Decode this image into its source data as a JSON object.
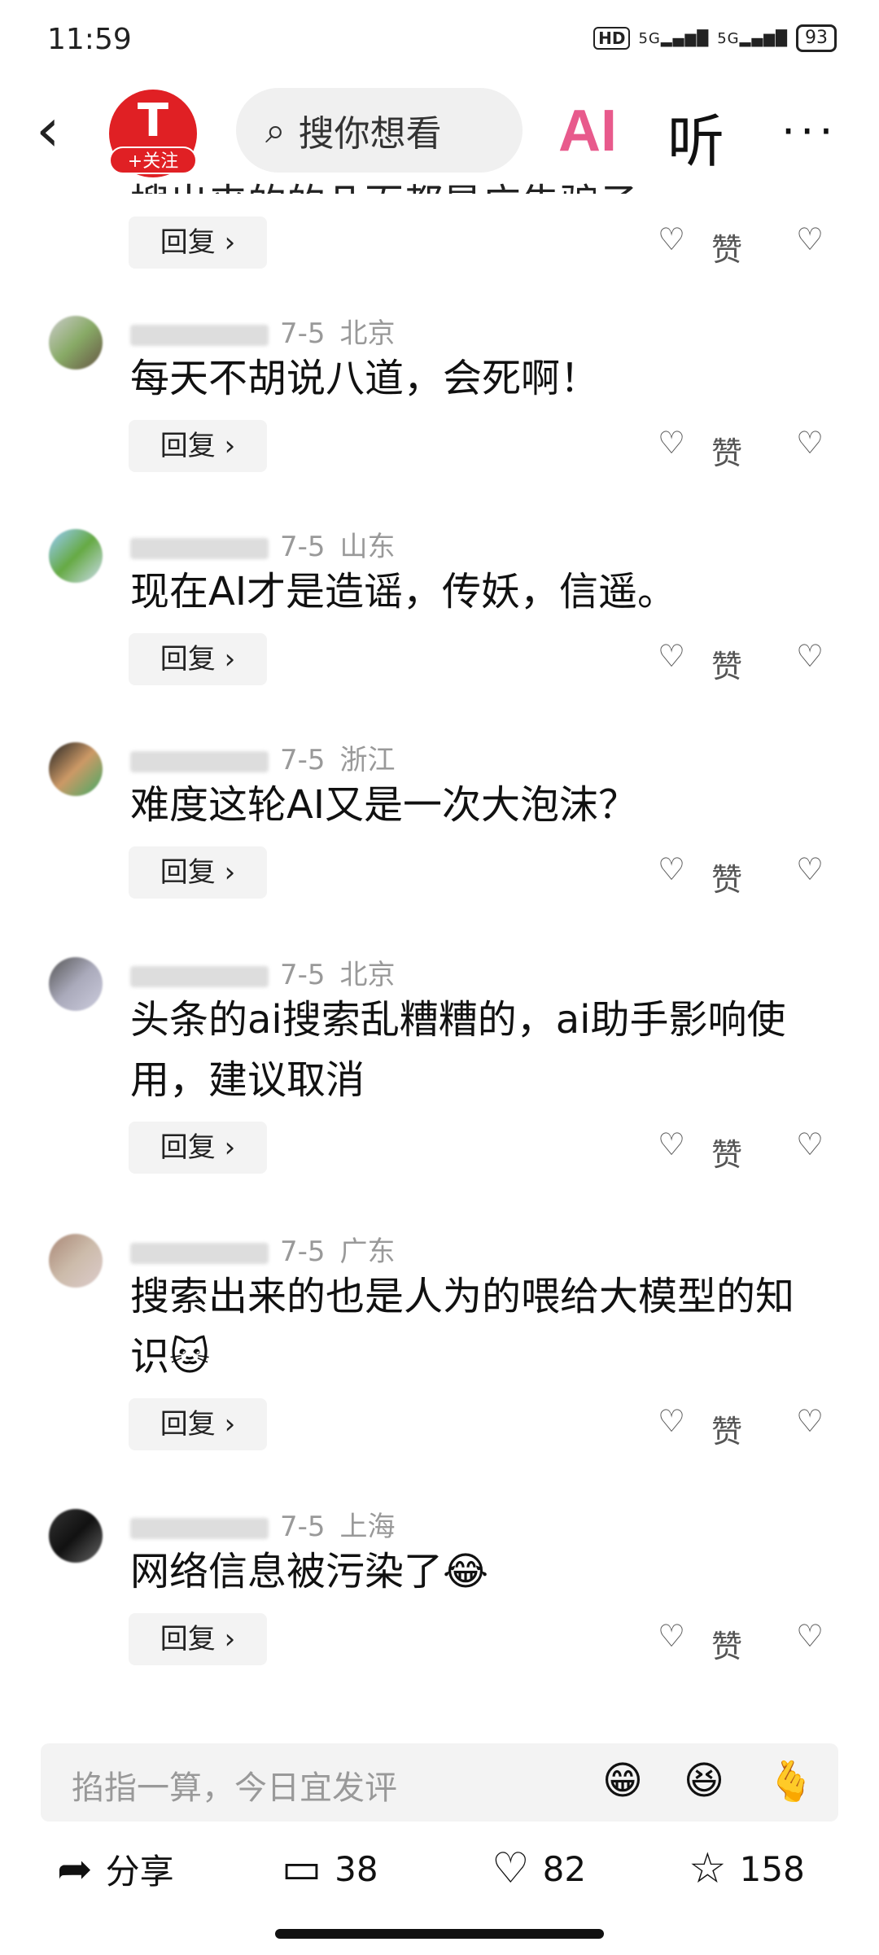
{
  "status": {
    "time": "11:59",
    "hd": "HD",
    "sig1": "5G",
    "sig2": "5G",
    "battery": "93"
  },
  "header": {
    "back_icon": "chevron-left-icon",
    "logo_letter": "T",
    "follow_label": "+关注",
    "search_placeholder": "搜你想看",
    "ai_label": "AI",
    "listen_label": "听",
    "more_icon": "more-icon"
  },
  "partial_text": "搜出来的的几百都是广告骗子",
  "actions": {
    "reply_label": "回复 ›",
    "like_label": "赞",
    "like_icon": "heart-icon",
    "dislike_icon": "broken-heart-icon"
  },
  "comments": [
    {
      "date": "7-5",
      "location": "北京",
      "text": "每天不胡说八道，会死啊！",
      "avatar_colors": [
        "#ccc",
        "#8a6",
        "#654"
      ]
    },
    {
      "date": "7-5",
      "location": "山东",
      "text": "现在AI才是造谣，传妖，信遥。",
      "avatar_colors": [
        "#9cf",
        "#6a4",
        "#cde"
      ]
    },
    {
      "date": "7-5",
      "location": "浙江",
      "text": "难度这轮AI又是一次大泡沫？",
      "avatar_colors": [
        "#222",
        "#c96",
        "#4a6"
      ]
    },
    {
      "date": "7-5",
      "location": "北京",
      "text": "头条的ai搜索乱糟糟的，ai助手影响使用，建议取消",
      "avatar_colors": [
        "#555",
        "#aab",
        "#ccd"
      ]
    },
    {
      "date": "7-5",
      "location": "广东",
      "text": "搜索出来的也是人为的喂给大模型的知识🐱",
      "avatar_colors": [
        "#a87",
        "#cba",
        "#dcc"
      ]
    },
    {
      "date": "7-5",
      "location": "上海",
      "text": "网络信息被污染了😂",
      "avatar_colors": [
        "#333",
        "#111",
        "#666"
      ]
    }
  ],
  "input": {
    "placeholder": "掐指一算，今日宜发评",
    "emoji1": "😁",
    "emoji2": "😆",
    "emoji3": "🫰"
  },
  "bottom": {
    "share_label": "分享",
    "comment_count": "38",
    "like_count": "82",
    "fav_count": "158",
    "share_icon": "share-icon",
    "comment_icon": "comment-icon",
    "like_icon": "heart-icon",
    "fav_icon": "star-icon"
  }
}
